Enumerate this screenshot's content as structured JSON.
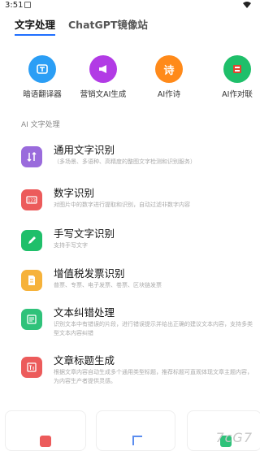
{
  "status_bar": {
    "time": "3:51"
  },
  "tabs": [
    {
      "label": "文字处理",
      "active": true
    },
    {
      "label": "ChatGPT镜像站",
      "active": false
    }
  ],
  "tools": [
    {
      "label": "暗语翻译器",
      "icon": "translate-icon",
      "color": "#2b9ef5"
    },
    {
      "label": "营销文AI生成",
      "icon": "megaphone-icon",
      "color": "#b23be5"
    },
    {
      "label": "AI作诗",
      "icon": "poem-icon",
      "color": "#ff8a1a",
      "glyph": "诗"
    },
    {
      "label": "AI作对联",
      "icon": "couplet-icon",
      "color": "#1fbf6a"
    }
  ],
  "section_title": "AI 文字处理",
  "items": [
    {
      "title": "通用文字识别",
      "desc": "（多场景、多语种、高精度的整图文字检测和识别服务）",
      "icon": "text-scan-icon",
      "color": "#9a6bdc"
    },
    {
      "title": "数字识别",
      "desc": "对图片中的数字进行提取和识别，自动过滤非数字内容",
      "icon": "number-icon",
      "color": "#ec5b5b"
    },
    {
      "title": "手写文字识别",
      "desc": "支持手写文字",
      "icon": "pen-icon",
      "color": "#1fbf6a"
    },
    {
      "title": "增值税发票识别",
      "desc": "普票、专票、电子发票、卷票、区块链发票",
      "icon": "invoice-icon",
      "color": "#f6b23a"
    },
    {
      "title": "文本纠错处理",
      "desc": "识别文本中有错误的片段，进行错误提示并给出正确的建议文本内容，支持多类型文本内容纠错",
      "icon": "proofread-icon",
      "color": "#2fc27a"
    },
    {
      "title": "文章标题生成",
      "desc": "根据文章内容自动生成多个通用类型标题，推荐标题可直观体现文章主题内容，为内容生产者提供灵感。",
      "icon": "title-icon",
      "color": "#ec5b5b"
    }
  ],
  "watermark": "7cG7"
}
